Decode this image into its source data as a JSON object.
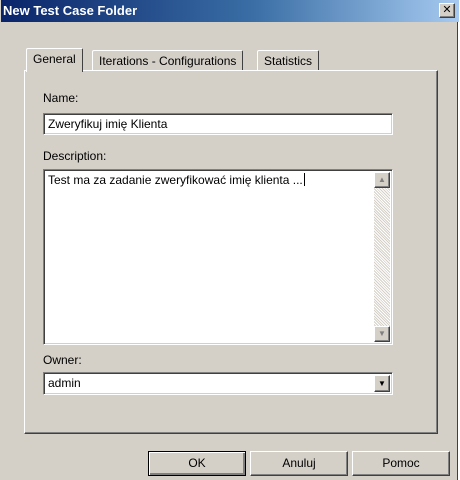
{
  "window": {
    "title": "New Test Case Folder",
    "close_glyph": "✕"
  },
  "tabs": [
    {
      "label": "General",
      "active": true
    },
    {
      "label": "Iterations - Configurations",
      "active": false
    },
    {
      "label": "Statistics",
      "active": false
    }
  ],
  "form": {
    "name_label": "Name:",
    "name_value": "Zweryfikuj imię Klienta",
    "description_label": "Description:",
    "description_value": "Test ma za zadanie zweryfikować imię klienta ...",
    "owner_label": "Owner:",
    "owner_value": "admin"
  },
  "icons": {
    "scroll_up": "▲",
    "scroll_down": "▼",
    "dropdown": "▼"
  },
  "buttons": {
    "ok": "OK",
    "cancel": "Anuluj",
    "help": "Pomoc"
  },
  "colors": {
    "titlebar_start": "#0a246a",
    "titlebar_end": "#a6caf0",
    "face": "#d4d0c8"
  }
}
